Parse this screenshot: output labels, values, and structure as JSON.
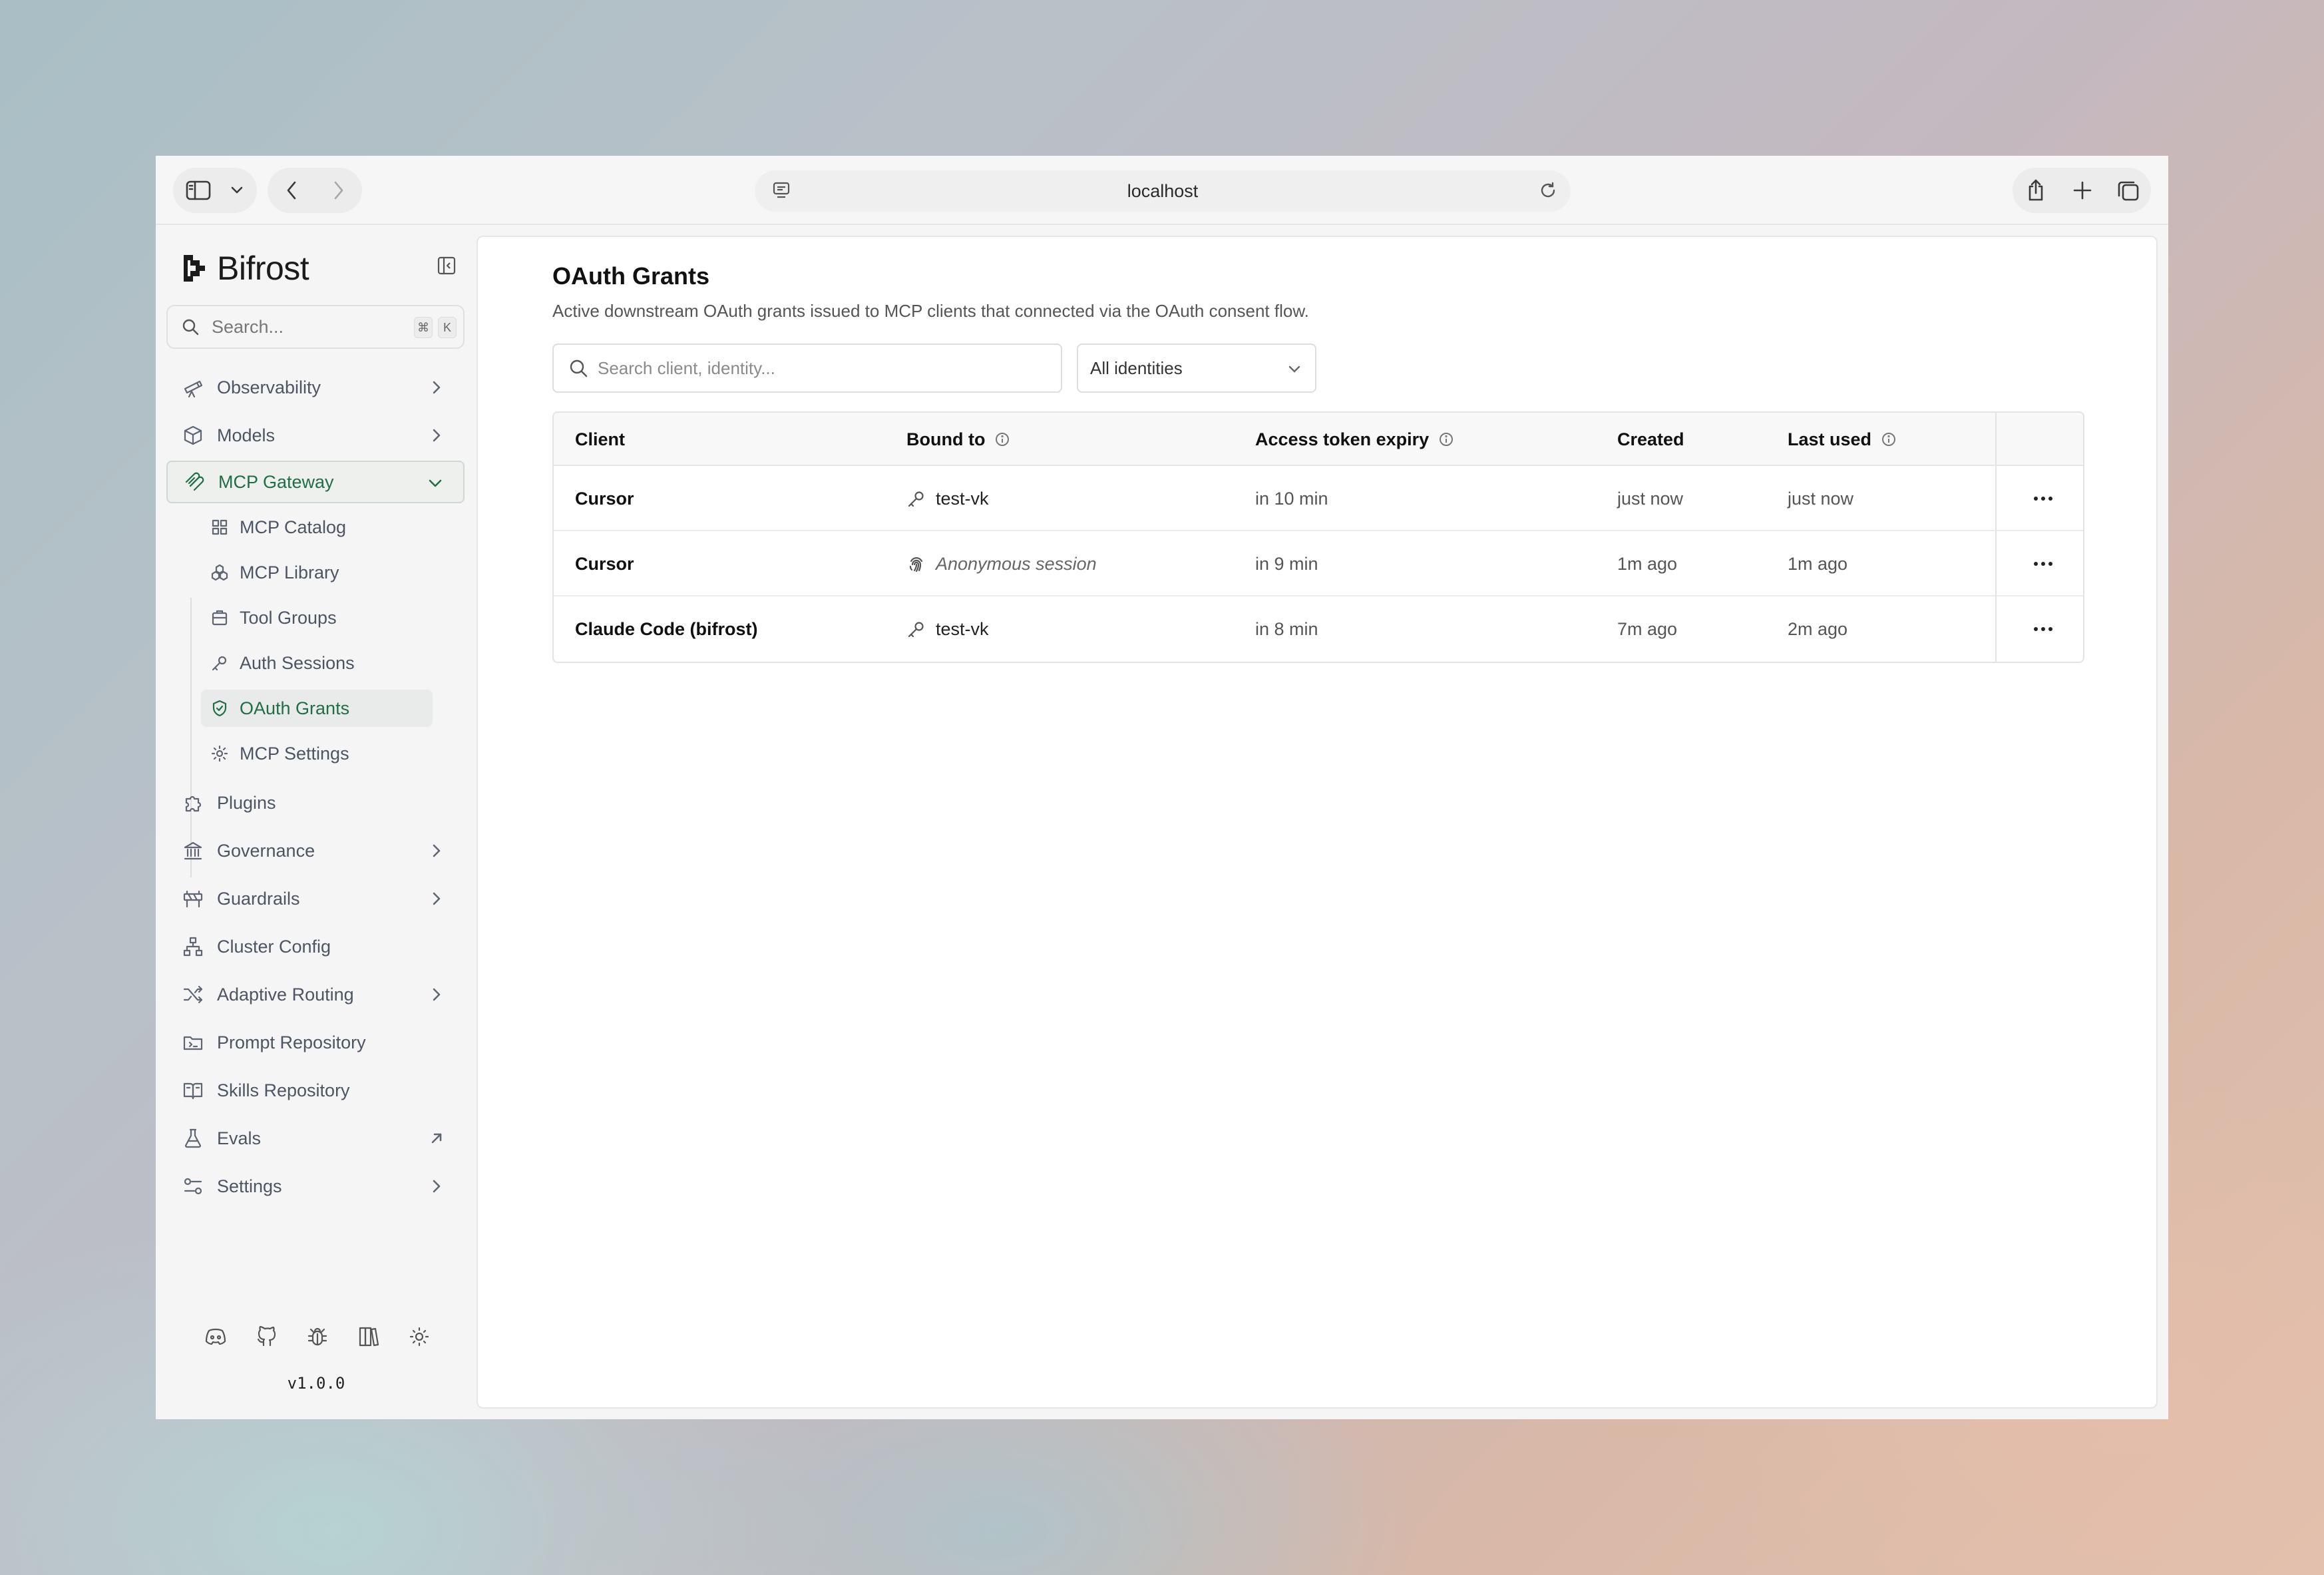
{
  "browser": {
    "url": "localhost"
  },
  "app": {
    "name": "Bifrost",
    "version": "v1.0.0"
  },
  "sidebar": {
    "search_placeholder": "Search...",
    "shortcut": [
      "⌘",
      "K"
    ],
    "items": [
      {
        "label": "Observability",
        "icon": "telescope-icon",
        "chevron": true
      },
      {
        "label": "Models",
        "icon": "cube-icon",
        "chevron": true
      },
      {
        "label": "MCP Gateway",
        "icon": "mcp-icon",
        "chevron": true,
        "expanded": true
      },
      {
        "label": "Plugins",
        "icon": "puzzle-icon"
      },
      {
        "label": "Governance",
        "icon": "landmark-icon",
        "chevron": true
      },
      {
        "label": "Guardrails",
        "icon": "barrier-icon",
        "chevron": true
      },
      {
        "label": "Cluster Config",
        "icon": "network-icon"
      },
      {
        "label": "Adaptive Routing",
        "icon": "shuffle-icon",
        "chevron": true
      },
      {
        "label": "Prompt Repository",
        "icon": "folder-icon"
      },
      {
        "label": "Skills Repository",
        "icon": "book-icon"
      },
      {
        "label": "Evals",
        "icon": "flask-icon",
        "external": true
      },
      {
        "label": "Settings",
        "icon": "sliders-icon",
        "chevron": true
      }
    ],
    "mcp_sub_items": [
      {
        "label": "MCP Catalog",
        "icon": "grid-icon"
      },
      {
        "label": "MCP Library",
        "icon": "boxes-icon"
      },
      {
        "label": "Tool Groups",
        "icon": "package-icon"
      },
      {
        "label": "Auth Sessions",
        "icon": "key-icon"
      },
      {
        "label": "OAuth Grants",
        "icon": "shield-check-icon",
        "active": true
      },
      {
        "label": "MCP Settings",
        "icon": "gear-icon"
      }
    ],
    "footer_icons": [
      "discord-icon",
      "github-icon",
      "bug-icon",
      "docs-icon",
      "sun-icon"
    ]
  },
  "page": {
    "title": "OAuth Grants",
    "description": "Active downstream OAuth grants issued to MCP clients that connected via the OAuth consent flow.",
    "search_placeholder": "Search client, identity...",
    "identity_filter": "All identities"
  },
  "table": {
    "columns": [
      "Client",
      "Bound to",
      "Access token expiry",
      "Created",
      "Last used"
    ],
    "rows": [
      {
        "client": "Cursor",
        "bound_to": "test-vk",
        "bound_icon": "key-icon",
        "expiry": "in 10 min",
        "created": "just now",
        "last_used": "just now"
      },
      {
        "client": "Cursor",
        "bound_to": "Anonymous session",
        "bound_icon": "fingerprint-icon",
        "expiry": "in 9 min",
        "created": "1m ago",
        "last_used": "1m ago"
      },
      {
        "client": "Claude Code (bifrost)",
        "bound_to": "test-vk",
        "bound_icon": "key-icon",
        "expiry": "in 8 min",
        "created": "7m ago",
        "last_used": "2m ago"
      }
    ]
  },
  "colors": {
    "accent": "#1f6f45"
  }
}
